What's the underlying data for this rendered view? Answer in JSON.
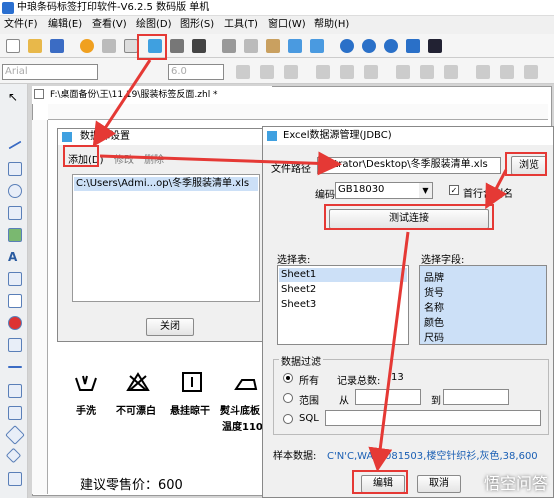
{
  "app": {
    "title": "中琅条码标签打印软件-V6.2.5 数码版 单机"
  },
  "menu": [
    "文件(F)",
    "编辑(E)",
    "查看(V)",
    "绘图(D)",
    "图形(S)",
    "工具(T)",
    "窗口(W)",
    "帮助(H)"
  ],
  "font": {
    "name": "Arial",
    "size": "6.0"
  },
  "doc_tab": "F:\\桌面备份\\王\\11.19\\服装标签反面.zhl *",
  "dlg_db": {
    "title": "数据库设置",
    "add": "添加(D)",
    "modify": "修改",
    "delete": "删除",
    "entry": "C:\\Users\\Admi...op\\冬季服装清单.xls",
    "close": "关闭"
  },
  "dlg_excel": {
    "title": "Excel数据源管理(JDBC)",
    "path_label": "文件路径",
    "path_value": "nistrator\\Desktop\\冬季服装清单.xls",
    "browse": "浏览",
    "encoding_label": "编码:",
    "encoding_value": "GB18030",
    "first_row_label": "首行含列名",
    "test_conn": "测试连接",
    "tables_label": "选择表:",
    "tables": [
      "Sheet1",
      "Sheet2",
      "Sheet3"
    ],
    "fields_label": "选择字段:",
    "fields": [
      "品牌",
      "货号",
      "名称",
      "颜色",
      "尺码"
    ],
    "filter_label": "数据过滤",
    "filter_all": "所有",
    "record_total": "记录总数:",
    "record_count": "13",
    "filter_range": "范围",
    "from": "从",
    "to": "到",
    "sql": "SQL",
    "sample_label": "样本数据:",
    "sample_value": "C'N'C,WA6?081503,楼空针织衫,灰色,38,600",
    "edit": "编辑",
    "cancel": "取消"
  },
  "label_care": [
    "手洗",
    "不可漂白",
    "悬挂晾干",
    "熨斗底板",
    "温度110"
  ],
  "label_price": "建议零售价：600",
  "watermark": "悟空问答",
  "colors": {
    "highlight_red": "#e53935",
    "accent_blue": "#1a5fb4"
  }
}
